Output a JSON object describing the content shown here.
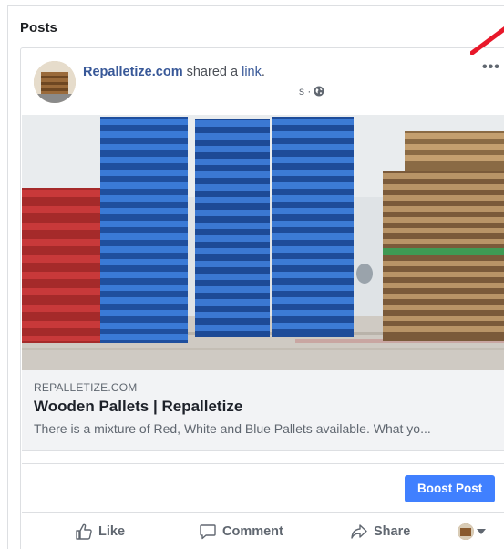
{
  "section": {
    "title": "Posts"
  },
  "post": {
    "page_name": "Repalletize.com",
    "action_text": " shared a ",
    "link_word": "link",
    "link_period": ".",
    "timestamp": "s ·",
    "more_label": "•••",
    "avatar_icon": "pallets-thumbnail",
    "privacy_icon": "globe-icon"
  },
  "photo": {
    "subject": "stacks of red, blue and wooden pallets"
  },
  "link_preview": {
    "domain": "REPALLETIZE.COM",
    "title": "Wooden Pallets | Repalletize",
    "description": "There is a mixture of Red, White and Blue Pallets available. What yo..."
  },
  "boost": {
    "label": "Boost Post",
    "color": "#4080ff"
  },
  "actions": {
    "like": "Like",
    "comment": "Comment",
    "share": "Share"
  },
  "colors": {
    "link": "#385898",
    "muted": "#606770",
    "annotation": "#e8182a"
  }
}
